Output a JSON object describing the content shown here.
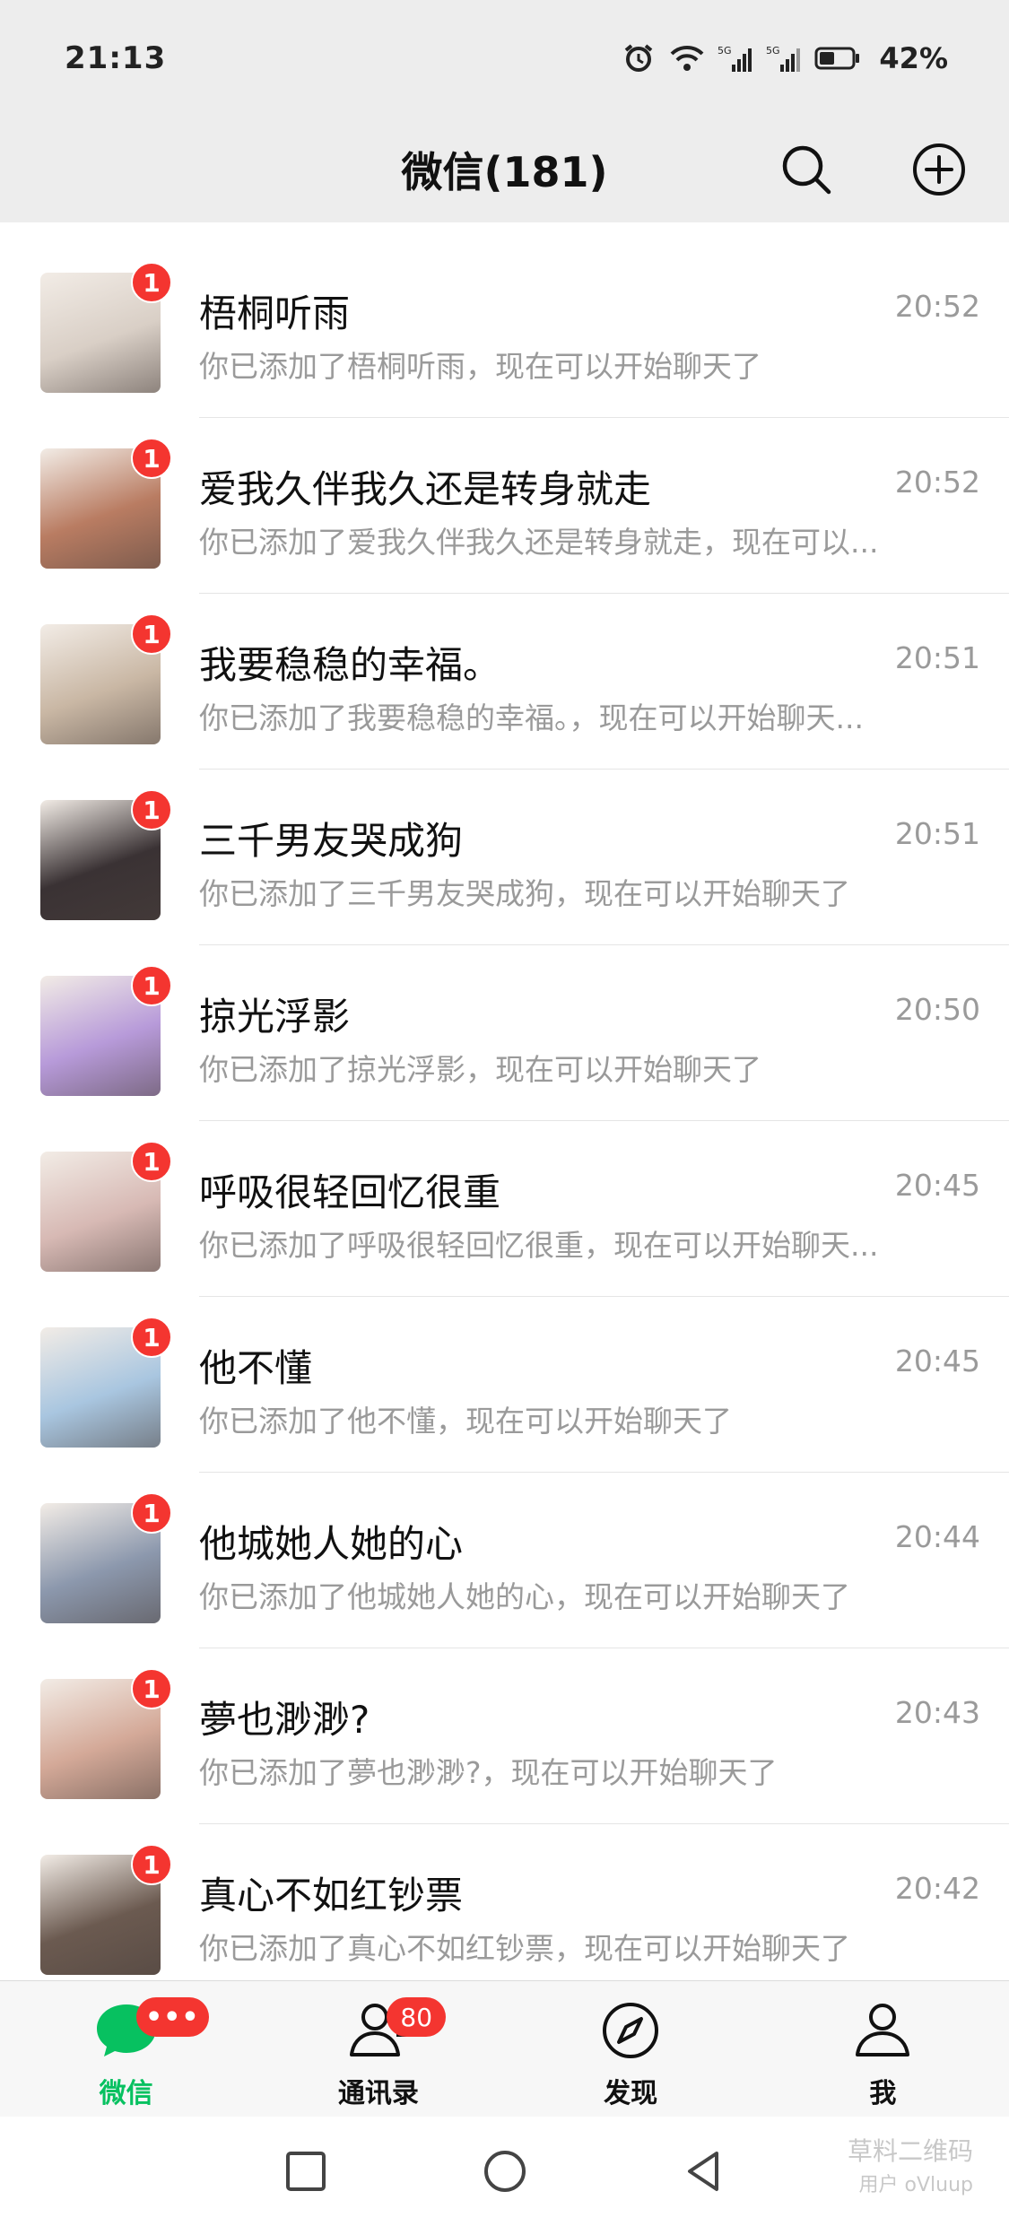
{
  "status_bar": {
    "time": "21:13",
    "battery_percent": "42%",
    "icons": [
      "alarm-icon",
      "wifi-icon",
      "signal-5g-icon",
      "signal-5g-icon",
      "battery-icon"
    ]
  },
  "header": {
    "title": "微信(181)",
    "search_icon": "search-icon",
    "add_icon": "plus-circle-icon"
  },
  "chats": [
    {
      "name": "梧桐听雨",
      "time": "20:52",
      "preview": "你已添加了梧桐听雨，现在可以开始聊天了",
      "unread": "1",
      "avatar_color": "#d9cfc6"
    },
    {
      "name": "爱我久伴我久还是转身就走",
      "time": "20:52",
      "preview": "你已添加了爱我久伴我久还是转身就走，现在可以...",
      "unread": "1",
      "avatar_color": "#b97c62"
    },
    {
      "name": "我要稳稳的幸福。",
      "time": "20:51",
      "preview": "你已添加了我要稳稳的幸福。，现在可以开始聊天...",
      "unread": "1",
      "avatar_color": "#c9b7a4"
    },
    {
      "name": "三千男友哭成狗",
      "time": "20:51",
      "preview": "你已添加了三千男友哭成狗，现在可以开始聊天了",
      "unread": "1",
      "avatar_color": "#3a3234"
    },
    {
      "name": "掠光浮影",
      "time": "20:50",
      "preview": "你已添加了掠光浮影，现在可以开始聊天了",
      "unread": "1",
      "avatar_color": "#b79ad9"
    },
    {
      "name": "呼吸很轻回忆很重",
      "time": "20:45",
      "preview": "你已添加了呼吸很轻回忆很重，现在可以开始聊天...",
      "unread": "1",
      "avatar_color": "#d7b9b4"
    },
    {
      "name": "他不懂",
      "time": "20:45",
      "preview": "你已添加了他不懂，现在可以开始聊天了",
      "unread": "1",
      "avatar_color": "#a9c6e0"
    },
    {
      "name": "他城她人她的心",
      "time": "20:44",
      "preview": "你已添加了他城她人她的心，现在可以开始聊天了",
      "unread": "1",
      "avatar_color": "#8c98ad"
    },
    {
      "name": "夢也渺渺?",
      "time": "20:43",
      "preview": "你已添加了夢也渺渺?，现在可以开始聊天了",
      "unread": "1",
      "avatar_color": "#d4a998"
    },
    {
      "name": "真心不如红钞票",
      "time": "20:42",
      "preview": "你已添加了真心不如红钞票，现在可以开始聊天了",
      "unread": "1",
      "avatar_color": "#6b5a50"
    }
  ],
  "tabs": [
    {
      "label": "微信",
      "icon": "chat-bubble-icon",
      "badge": "•••",
      "active": true
    },
    {
      "label": "通讯录",
      "icon": "contacts-icon",
      "badge": "80",
      "active": false
    },
    {
      "label": "发现",
      "icon": "compass-icon",
      "badge": "",
      "active": false
    },
    {
      "label": "我",
      "icon": "person-icon",
      "badge": "",
      "active": false
    }
  ],
  "nav": {
    "icons": [
      "recents-square-icon",
      "home-circle-icon",
      "back-triangle-icon"
    ]
  },
  "watermark": {
    "line1": "草料二维码",
    "line2": "用户 oVluup"
  },
  "colors": {
    "accent": "#07c160",
    "badge": "#f43530",
    "header_bg": "#ededed",
    "muted_text": "#9a9a9a"
  }
}
